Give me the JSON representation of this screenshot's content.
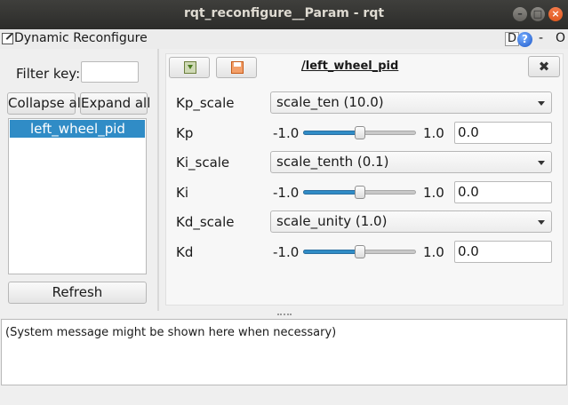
{
  "window": {
    "title": "rqt_reconfigure__Param - rqt",
    "minimize_glyph": "–",
    "maximize_glyph": "□",
    "close_glyph": "×"
  },
  "plugin": {
    "title": "Dynamic Reconfigure",
    "d_label": "D",
    "help_glyph": "?",
    "minus_label": "-",
    "o_label": "O"
  },
  "sidebar": {
    "filter_label": "Filter key:",
    "filter_value": "",
    "collapse_label": "Collapse all",
    "expand_label": "Expand all",
    "tree_items": [
      "left_wheel_pid"
    ],
    "refresh_label": "Refresh"
  },
  "editor": {
    "node_name": "/left_wheel_pid",
    "close_glyph": "✖",
    "params": [
      {
        "label": "Kp_scale",
        "type": "enum",
        "value": "scale_ten (10.0)"
      },
      {
        "label": "Kp",
        "type": "double",
        "min": "-1.0",
        "max": "1.0",
        "value": "0.0",
        "fraction": 0.5
      },
      {
        "label": "Ki_scale",
        "type": "enum",
        "value": "scale_tenth (0.1)"
      },
      {
        "label": "Ki",
        "type": "double",
        "min": "-1.0",
        "max": "1.0",
        "value": "0.0",
        "fraction": 0.5
      },
      {
        "label": "Kd_scale",
        "type": "enum",
        "value": "scale_unity (1.0)"
      },
      {
        "label": "Kd",
        "type": "double",
        "min": "-1.0",
        "max": "1.0",
        "value": "0.0",
        "fraction": 0.5
      }
    ]
  },
  "messages": {
    "text": "(System message might be shown here when necessary)"
  },
  "colors": {
    "selection": "#308cc6",
    "titlebar": "#3c3b37",
    "close_button": "#e9541d"
  }
}
